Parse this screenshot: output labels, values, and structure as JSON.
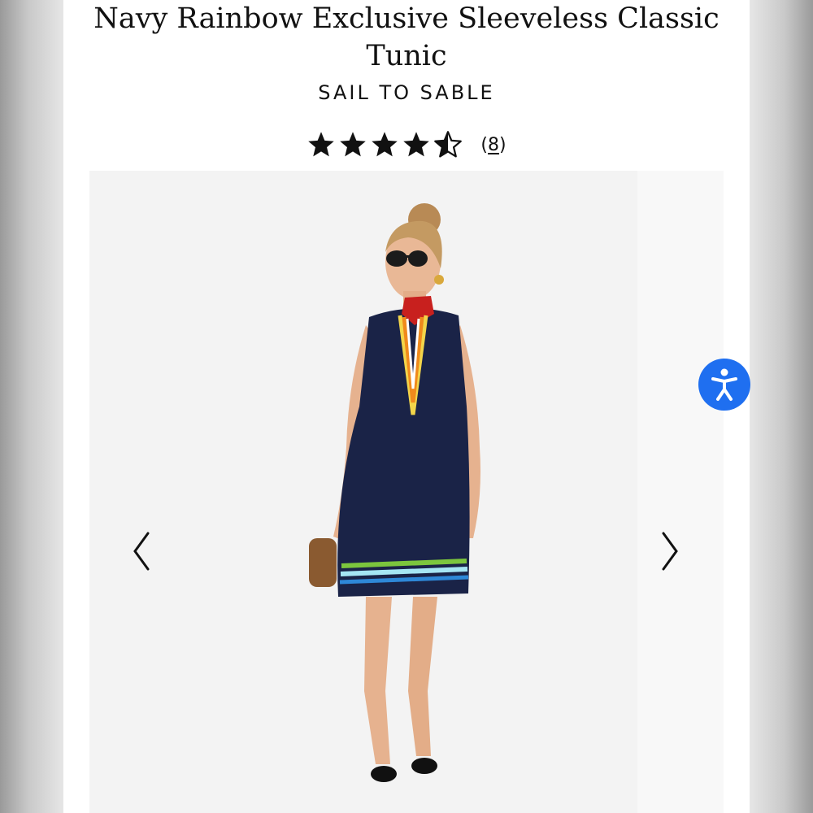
{
  "product": {
    "title": "Navy Rainbow Exclusive Sleeveless Classic Tunic",
    "brand": "SAIL TO SABLE",
    "rating": 4.5,
    "review_count_open": "(",
    "review_count": "8",
    "review_count_close": ")"
  },
  "icons": {
    "prev": "chevron-left-icon",
    "next": "chevron-right-icon",
    "accessibility": "accessibility-icon",
    "star": "star-icon",
    "half_star": "half-star-icon"
  },
  "colors": {
    "accessibility_button": "#1f6ff0",
    "dress_navy": "#1a2347"
  }
}
